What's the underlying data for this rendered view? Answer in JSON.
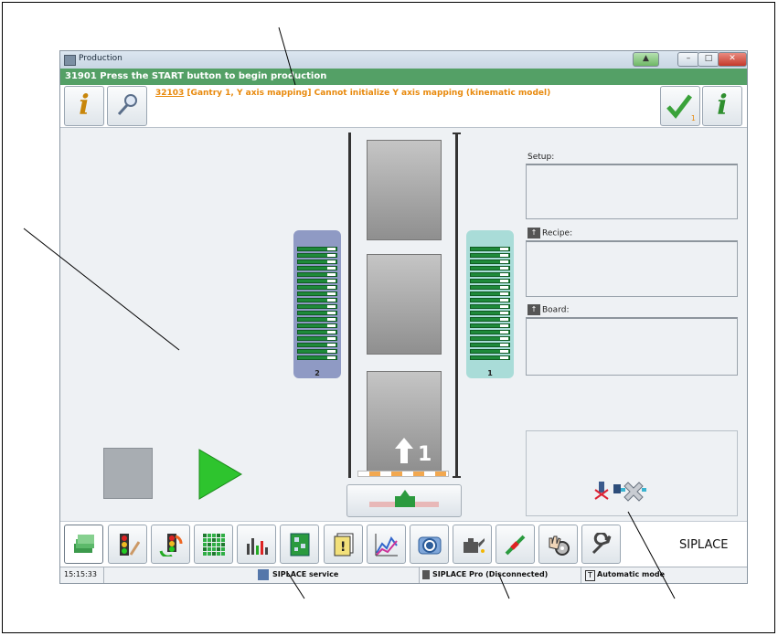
{
  "window": {
    "title": "Production"
  },
  "status_message": "31901 Press the START button to begin production",
  "error": {
    "code": "32103",
    "text": " [Gantry 1, Y axis mapping] Cannot initialize Y axis mapping (kinematic model)"
  },
  "ack_count": "1",
  "feeders": {
    "left_number": "2",
    "right_number": "1"
  },
  "conveyor": {
    "lane_number": "1"
  },
  "info": {
    "setup_label": "Setup:",
    "recipe_label": "Recipe:",
    "board_label": "Board:"
  },
  "toolbar": {
    "brand": "SIPLACE"
  },
  "statusbar": {
    "time": "15:15:33",
    "service": "SIPLACE service",
    "pro": "SIPLACE Pro (Disconnected)",
    "mode": "Automatic mode"
  },
  "colors": {
    "status_green": "#54a066",
    "error_orange": "#e8890c",
    "feeder_left": "#8f9ac4",
    "feeder_right": "#a9dcd8"
  }
}
